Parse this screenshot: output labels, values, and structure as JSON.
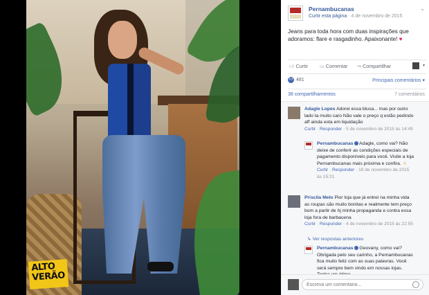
{
  "photo": {
    "badge_line1": "ALTO",
    "badge_line2": "VERÃO"
  },
  "post": {
    "page_name": "Pernambucanas",
    "follow_link": "Curtir esta página",
    "separator": "·",
    "date": "4 de novembro de 2015",
    "text": "Jeans para toda hora com duas inspirações que adoramos: flare e rasgadinho. Apaixonante! ",
    "heart": "♥"
  },
  "actions": {
    "like": "Curtir",
    "comment": "Comentar",
    "share": "Compartilhar"
  },
  "reactions": {
    "count": "481",
    "relevant": "Principais comentários ▾"
  },
  "counts": {
    "shares": "38 compartilhamentos",
    "comments": "7 comentários"
  },
  "comments": [
    {
      "name": "Adagle Lopes",
      "text": " Adorei essa blusa... mas por outro lado ta muito caro Não vale o preço q estão pedindo aff ainda esta em liquidação",
      "like": "Curtir",
      "reply": "Responder",
      "date": "5 de novembro de 2015 às 14:45"
    },
    {
      "name": "Pernambucanas",
      "text": " Adagle, como vai? Não deixe de conferir as condições especiais de pagamento disponíveis para você. Visite a loja Pernambucanas mais próxima e confira. ",
      "emoji": "☺",
      "like": "Curtir",
      "reply": "Responder",
      "date": "18 de novembro de 2015 às 15:21"
    },
    {
      "name": "Priscila Melo",
      "text": " Pior loja que já entrei na minha vida as roupas são muito bonitas e realmente tem preço bom a partir de hj minha propaganda e contra essa loja fora de barbacena",
      "like": "Curtir",
      "reply": "Responder",
      "date": "4 de novembro de 2015 às 22:55"
    },
    {
      "name": "Pernambucanas",
      "text": " Geovany, como vai? Obrigada pelo seu carinho, a Pernambucanas fica muito feliz com as suas palavras. Você será sempre bem vindo em nossas lojas. Tenha um ótimo"
    }
  ],
  "previous_replies": "↳ Ver respostas anteriores",
  "reply_box": {
    "placeholder": "Escreva um comentário..."
  }
}
